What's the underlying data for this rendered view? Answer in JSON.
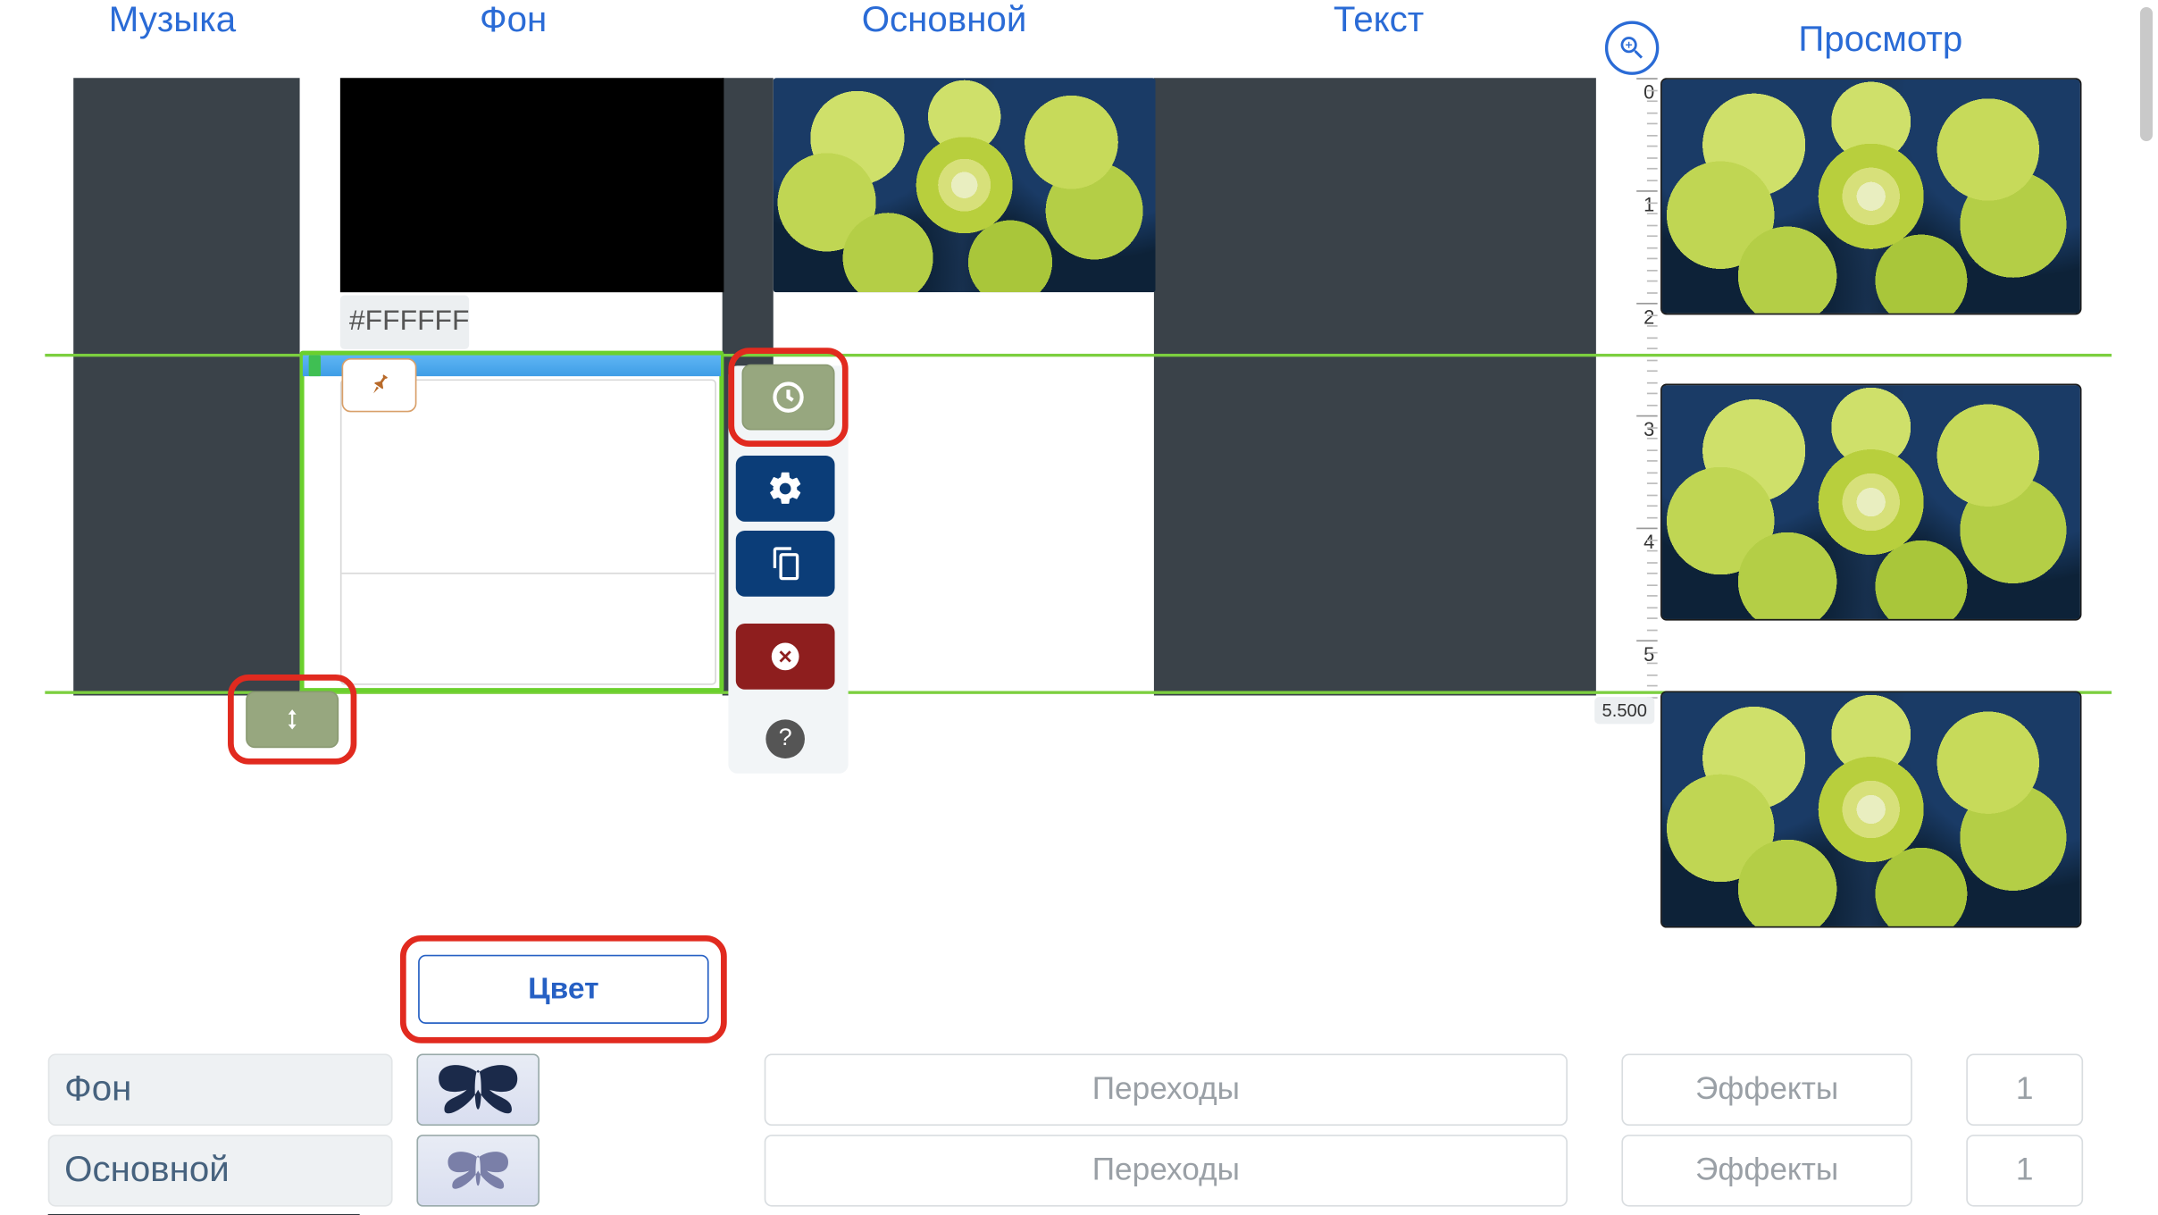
{
  "tabs": {
    "music": "Музыка",
    "background": "Фон",
    "main": "Основной",
    "text": "Текст"
  },
  "zoom_label": "Просмотр",
  "hex_value": "#FFFFFF",
  "ruler": {
    "ticks": [
      0,
      1,
      2,
      3,
      4,
      5
    ],
    "time_value": "5.500"
  },
  "color_button": "Цвет",
  "rows": [
    {
      "label": "Фон",
      "transitions": "Переходы",
      "effects": "Эффекты",
      "count": "1"
    },
    {
      "label": "Основной",
      "transitions": "Переходы",
      "effects": "Эффекты",
      "count": "1"
    }
  ],
  "highlights": {
    "clock_button": true,
    "resize_handle": true,
    "color_button": true
  }
}
